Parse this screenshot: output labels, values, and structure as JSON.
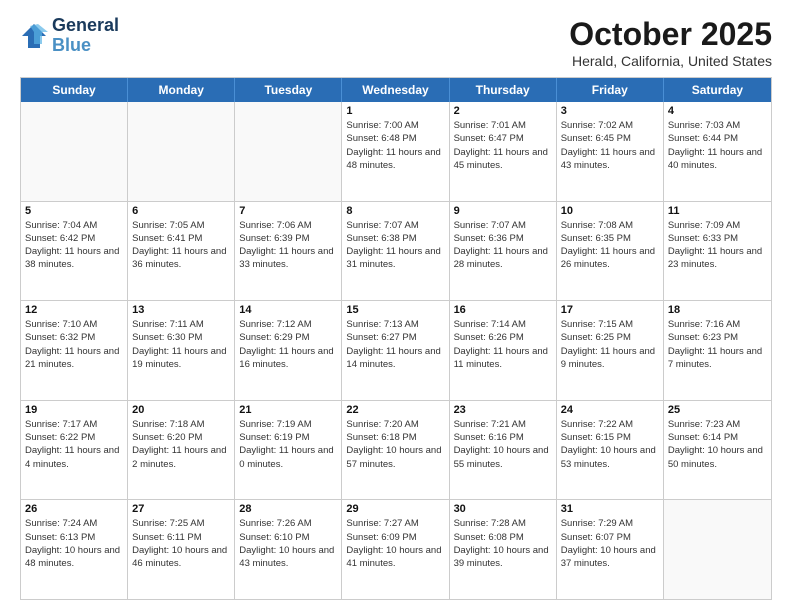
{
  "header": {
    "logo_line1": "General",
    "logo_line2": "Blue",
    "title": "October 2025",
    "subtitle": "Herald, California, United States"
  },
  "days_of_week": [
    "Sunday",
    "Monday",
    "Tuesday",
    "Wednesday",
    "Thursday",
    "Friday",
    "Saturday"
  ],
  "weeks": [
    [
      {
        "day": "",
        "empty": true
      },
      {
        "day": "",
        "empty": true
      },
      {
        "day": "",
        "empty": true
      },
      {
        "day": "1",
        "sunrise": "7:00 AM",
        "sunset": "6:48 PM",
        "daylight": "11 hours and 48 minutes."
      },
      {
        "day": "2",
        "sunrise": "7:01 AM",
        "sunset": "6:47 PM",
        "daylight": "11 hours and 45 minutes."
      },
      {
        "day": "3",
        "sunrise": "7:02 AM",
        "sunset": "6:45 PM",
        "daylight": "11 hours and 43 minutes."
      },
      {
        "day": "4",
        "sunrise": "7:03 AM",
        "sunset": "6:44 PM",
        "daylight": "11 hours and 40 minutes."
      }
    ],
    [
      {
        "day": "5",
        "sunrise": "7:04 AM",
        "sunset": "6:42 PM",
        "daylight": "11 hours and 38 minutes."
      },
      {
        "day": "6",
        "sunrise": "7:05 AM",
        "sunset": "6:41 PM",
        "daylight": "11 hours and 36 minutes."
      },
      {
        "day": "7",
        "sunrise": "7:06 AM",
        "sunset": "6:39 PM",
        "daylight": "11 hours and 33 minutes."
      },
      {
        "day": "8",
        "sunrise": "7:07 AM",
        "sunset": "6:38 PM",
        "daylight": "11 hours and 31 minutes."
      },
      {
        "day": "9",
        "sunrise": "7:07 AM",
        "sunset": "6:36 PM",
        "daylight": "11 hours and 28 minutes."
      },
      {
        "day": "10",
        "sunrise": "7:08 AM",
        "sunset": "6:35 PM",
        "daylight": "11 hours and 26 minutes."
      },
      {
        "day": "11",
        "sunrise": "7:09 AM",
        "sunset": "6:33 PM",
        "daylight": "11 hours and 23 minutes."
      }
    ],
    [
      {
        "day": "12",
        "sunrise": "7:10 AM",
        "sunset": "6:32 PM",
        "daylight": "11 hours and 21 minutes."
      },
      {
        "day": "13",
        "sunrise": "7:11 AM",
        "sunset": "6:30 PM",
        "daylight": "11 hours and 19 minutes."
      },
      {
        "day": "14",
        "sunrise": "7:12 AM",
        "sunset": "6:29 PM",
        "daylight": "11 hours and 16 minutes."
      },
      {
        "day": "15",
        "sunrise": "7:13 AM",
        "sunset": "6:27 PM",
        "daylight": "11 hours and 14 minutes."
      },
      {
        "day": "16",
        "sunrise": "7:14 AM",
        "sunset": "6:26 PM",
        "daylight": "11 hours and 11 minutes."
      },
      {
        "day": "17",
        "sunrise": "7:15 AM",
        "sunset": "6:25 PM",
        "daylight": "11 hours and 9 minutes."
      },
      {
        "day": "18",
        "sunrise": "7:16 AM",
        "sunset": "6:23 PM",
        "daylight": "11 hours and 7 minutes."
      }
    ],
    [
      {
        "day": "19",
        "sunrise": "7:17 AM",
        "sunset": "6:22 PM",
        "daylight": "11 hours and 4 minutes."
      },
      {
        "day": "20",
        "sunrise": "7:18 AM",
        "sunset": "6:20 PM",
        "daylight": "11 hours and 2 minutes."
      },
      {
        "day": "21",
        "sunrise": "7:19 AM",
        "sunset": "6:19 PM",
        "daylight": "11 hours and 0 minutes."
      },
      {
        "day": "22",
        "sunrise": "7:20 AM",
        "sunset": "6:18 PM",
        "daylight": "10 hours and 57 minutes."
      },
      {
        "day": "23",
        "sunrise": "7:21 AM",
        "sunset": "6:16 PM",
        "daylight": "10 hours and 55 minutes."
      },
      {
        "day": "24",
        "sunrise": "7:22 AM",
        "sunset": "6:15 PM",
        "daylight": "10 hours and 53 minutes."
      },
      {
        "day": "25",
        "sunrise": "7:23 AM",
        "sunset": "6:14 PM",
        "daylight": "10 hours and 50 minutes."
      }
    ],
    [
      {
        "day": "26",
        "sunrise": "7:24 AM",
        "sunset": "6:13 PM",
        "daylight": "10 hours and 48 minutes."
      },
      {
        "day": "27",
        "sunrise": "7:25 AM",
        "sunset": "6:11 PM",
        "daylight": "10 hours and 46 minutes."
      },
      {
        "day": "28",
        "sunrise": "7:26 AM",
        "sunset": "6:10 PM",
        "daylight": "10 hours and 43 minutes."
      },
      {
        "day": "29",
        "sunrise": "7:27 AM",
        "sunset": "6:09 PM",
        "daylight": "10 hours and 41 minutes."
      },
      {
        "day": "30",
        "sunrise": "7:28 AM",
        "sunset": "6:08 PM",
        "daylight": "10 hours and 39 minutes."
      },
      {
        "day": "31",
        "sunrise": "7:29 AM",
        "sunset": "6:07 PM",
        "daylight": "10 hours and 37 minutes."
      },
      {
        "day": "",
        "empty": true
      }
    ]
  ]
}
